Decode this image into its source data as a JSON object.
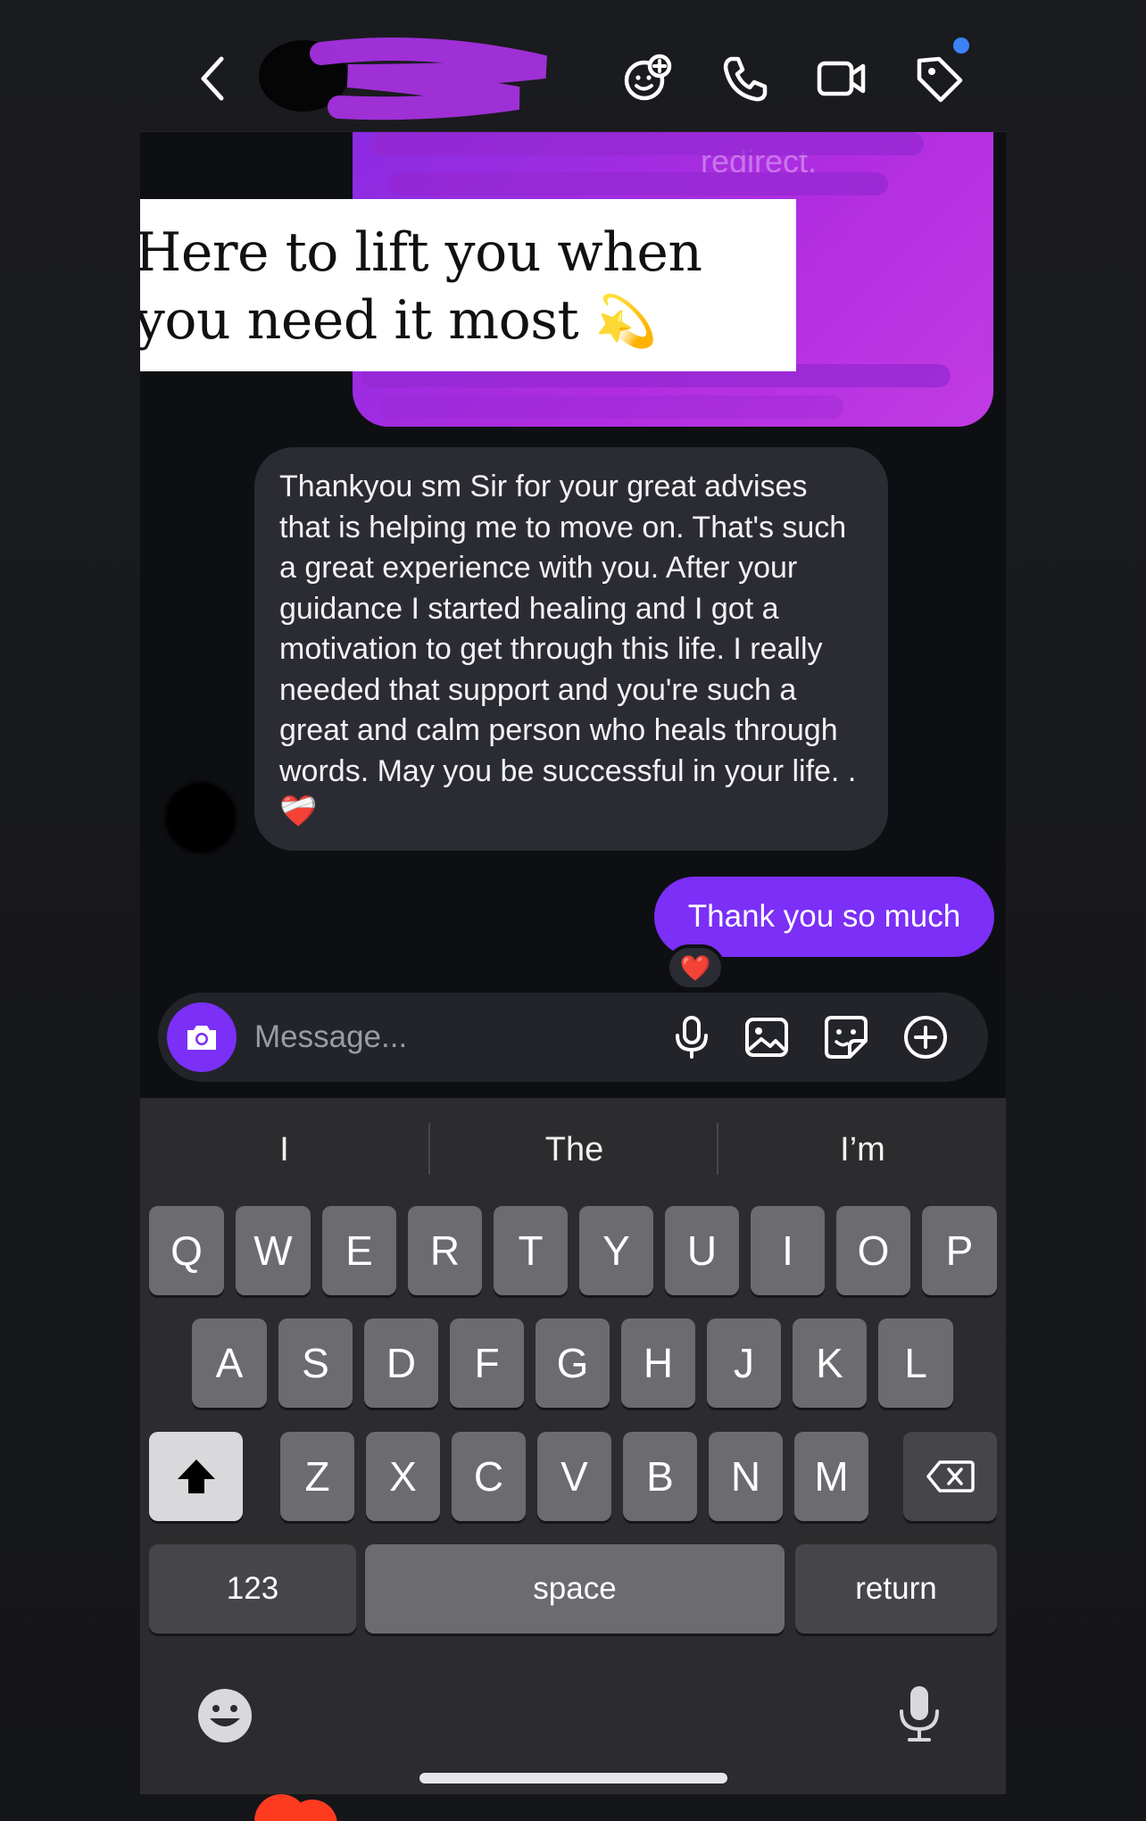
{
  "header": {
    "back_icon": "chevron-left-icon",
    "icons": [
      "sticker-add-icon",
      "phone-icon",
      "video-camera-icon",
      "tag-icon"
    ]
  },
  "chat": {
    "sent_image_overlay": {
      "text": "Here to lift you when you need it most",
      "emoji": "💫",
      "faint_text": "redirect."
    },
    "incoming_message": "Thankyou sm Sir for your great advises that is helping me to move on. That's such a great experience with you. After your guidance I started healing and I got a motivation to get through this life. I really needed that support and you're such a great and calm person who heals through words. May you be successful in your life. .❤️‍🩹",
    "outgoing_message": "Thank you so much",
    "reaction": "❤️"
  },
  "composer": {
    "placeholder": "Message...",
    "icons": [
      "camera-icon",
      "microphone-icon",
      "gallery-icon",
      "sticker-icon",
      "plus-circle-icon"
    ]
  },
  "keyboard": {
    "suggestions": [
      "I",
      "The",
      "I’m"
    ],
    "row1": [
      "Q",
      "W",
      "E",
      "R",
      "T",
      "Y",
      "U",
      "I",
      "O",
      "P"
    ],
    "row2": [
      "A",
      "S",
      "D",
      "F",
      "G",
      "H",
      "J",
      "K",
      "L"
    ],
    "row3": [
      "Z",
      "X",
      "C",
      "V",
      "B",
      "N",
      "M"
    ],
    "numbers_label": "123",
    "space_label": "space",
    "return_label": "return"
  },
  "colors": {
    "accent": "#7b2ff7",
    "incoming_bubble": "#2b2c33",
    "keyboard_bg": "#2c2c2e"
  }
}
